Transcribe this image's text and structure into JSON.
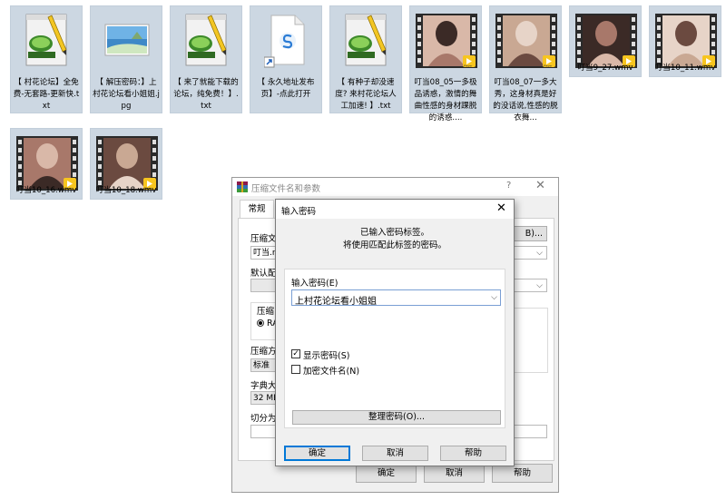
{
  "files": [
    {
      "name": "【 村花论坛】全免费-无套路-更新快.txt",
      "kind": "notepad"
    },
    {
      "name": "【 解压密码：】上村花论坛看小姐姐.jpg",
      "kind": "image"
    },
    {
      "name": "【 来了就能下载的论坛，纯免费！】.txt",
      "kind": "notepad"
    },
    {
      "name": "【 永久地址发布页】-点此打开",
      "kind": "shortcut"
    },
    {
      "name": "【 有种子却没速度? 来村花论坛人工加速! 】.txt",
      "kind": "notepad"
    },
    {
      "name": "叮当08_05一多极品诱惑，激情的舞曲性感的身材踝脱的诱惑....",
      "kind": "video"
    },
    {
      "name": "叮当08_07一多大秀，这身材真是好的没话说,性感的脱衣舞...",
      "kind": "video"
    },
    {
      "name": "叮当9_27.wmv",
      "kind": "video"
    },
    {
      "name": "叮当10_11.wmv",
      "kind": "video"
    },
    {
      "name": "叮当10_16.wmv",
      "kind": "video"
    },
    {
      "name": "叮当10_18.wmv",
      "kind": "video"
    }
  ],
  "player_badge": "Player",
  "colors": {
    "icon_bg": "#ccd7e2",
    "accent": "#0078d7",
    "notepad_green": "#3d8a2a"
  },
  "main_dialog": {
    "title": "压缩文件名和参数",
    "help": "?",
    "close": "✕",
    "tab_general": "常规",
    "archive_name_label": "压缩文",
    "archive_name_value": "叮当.r",
    "browse_suffix": "B)...",
    "default_profile_label": "默认配",
    "format_label": "压缩",
    "format_value": "RA",
    "method_label": "压缩方",
    "method_value": "标准",
    "dict_label": "字典大",
    "dict_value": "32 MB",
    "split_label": "切分为",
    "ok": "确定",
    "cancel": "取消",
    "help_btn": "帮助"
  },
  "pwd_dialog": {
    "title": "输入密码",
    "close": "✕",
    "msg1": "已输入密码标签。",
    "msg2": "将使用匹配此标签的密码。",
    "pwd_label": "输入密码(E)",
    "pwd_value": "上村花论坛看小姐姐",
    "show_pwd": "显示密码(S)",
    "show_pwd_checked": true,
    "encrypt_names": "加密文件名(N)",
    "encrypt_names_checked": false,
    "organize": "整理密码(O)...",
    "ok": "确定",
    "cancel": "取消",
    "help": "帮助"
  }
}
